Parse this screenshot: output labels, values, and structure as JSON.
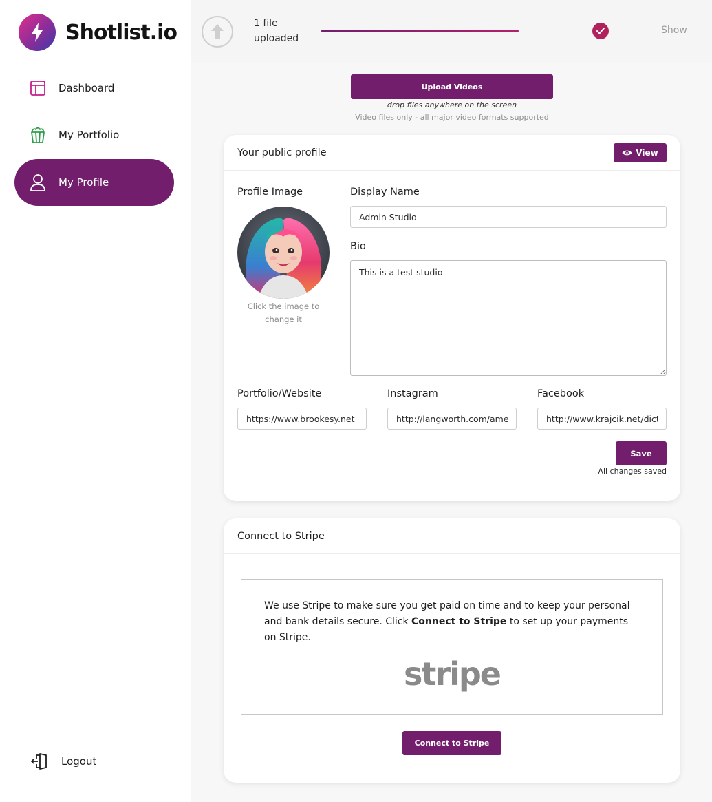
{
  "brand": {
    "name": "Shotlist.io",
    "logo_icon": "lightning-bolt-icon"
  },
  "sidebar": {
    "items": [
      {
        "label": "Dashboard",
        "icon": "layout-icon",
        "active": false
      },
      {
        "label": "My Portfolio",
        "icon": "popcorn-icon",
        "active": false
      },
      {
        "label": "My Profile",
        "icon": "user-icon",
        "active": true
      }
    ],
    "logout": {
      "label": "Logout",
      "icon": "logout-icon"
    }
  },
  "upload_bar": {
    "status_line1": "1 file",
    "status_line2": "uploaded",
    "progress": 1.0,
    "show_label": "Show"
  },
  "upload": {
    "button_label": "Upload Videos",
    "drop_hint": "drop files anywhere on the screen",
    "format_hint": "Video files only - all major video formats supported"
  },
  "profile": {
    "header": "Your public profile",
    "view_label": "View",
    "image_label": "Profile Image",
    "image_hint": "Click the image to change it",
    "display_name_label": "Display Name",
    "display_name_value": "Admin Studio",
    "bio_label": "Bio",
    "bio_value": "This is a test studio",
    "website_label": "Portfolio/Website",
    "website_value": "https://www.brookesy.net",
    "instagram_label": "Instagram",
    "instagram_value": "http://langworth.com/ame",
    "facebook_label": "Facebook",
    "facebook_value": "http://www.krajcik.net/dicto",
    "save_label": "Save",
    "saved_note": "All changes saved"
  },
  "stripe": {
    "header": "Connect to Stripe",
    "text_before": "We use Stripe to make sure you get paid on time and to keep your personal and bank details secure. Click ",
    "text_bold": "Connect to Stripe",
    "text_after": " to set up your payments on Stripe.",
    "logo_text": "stripe",
    "button_label": "Connect to Stripe"
  },
  "colors": {
    "accent": "#721e6c",
    "check": "#b0215e",
    "dashboard_icon": "#c81e8c",
    "portfolio_icon": "#2e9e4a"
  }
}
